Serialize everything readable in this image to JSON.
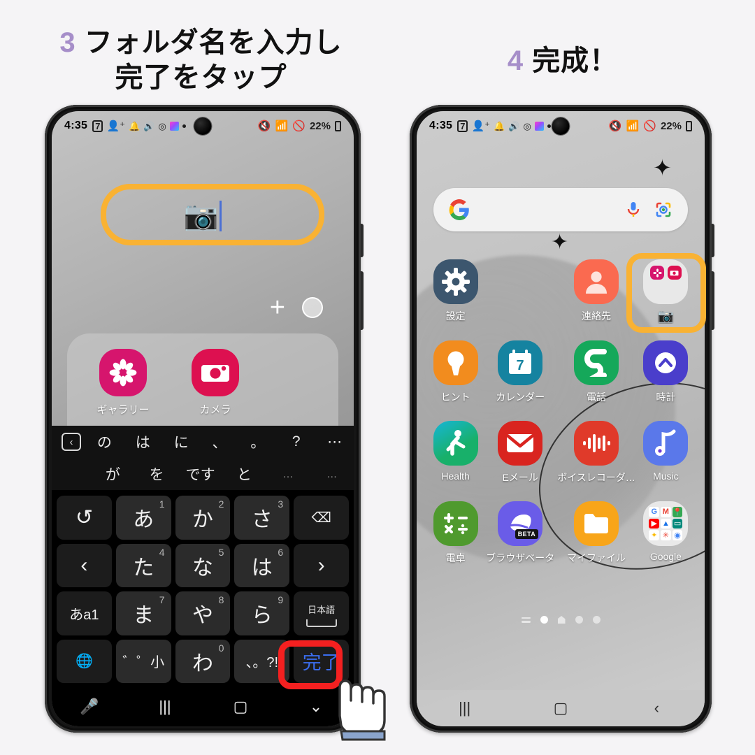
{
  "background_color": "#f5f4f6",
  "accent_color": "#a68ec9",
  "highlight_color": "#f9b233",
  "alert_color": "#f42020",
  "headings": {
    "left": {
      "number": "3",
      "line1": "フォルダ名を入力し",
      "line2": "完了をタップ"
    },
    "right": {
      "number": "4",
      "line1": "完成！",
      "line2": ""
    }
  },
  "status_bar": {
    "time": "4:35",
    "left_icons": [
      "calendar-icon",
      "add-contact-icon",
      "bell-icon",
      "volume-icon",
      "target-icon",
      "gallery-icon",
      "dot-icon"
    ],
    "right_icons": [
      "mute-icon",
      "wifi-icon",
      "dnd-icon"
    ],
    "battery": "22%"
  },
  "left_phone": {
    "folder_name_field": {
      "value": "📷",
      "caret": true
    },
    "tools": {
      "add_label": "+",
      "color_dot": "color-picker-dot"
    },
    "folder_apps": [
      {
        "label": "ギャラリー",
        "icon": "gallery-icon",
        "color": "#d6156d"
      },
      {
        "label": "カメラ",
        "icon": "camera-icon",
        "color": "#dd1050"
      }
    ],
    "keyboard": {
      "suggestions_row1": [
        "の",
        "は",
        "に",
        "、",
        "。",
        "?",
        "⋯"
      ],
      "suggestions_row2": [
        "が",
        "を",
        "です",
        "と",
        "…",
        "…"
      ],
      "keys": [
        {
          "label": "↺",
          "type": "fn",
          "name": "undo-key"
        },
        {
          "label": "あ",
          "num": "1",
          "type": "char",
          "name": "key-a"
        },
        {
          "label": "か",
          "num": "2",
          "type": "char",
          "name": "key-ka"
        },
        {
          "label": "さ",
          "num": "3",
          "type": "char",
          "name": "key-sa"
        },
        {
          "label": "⌫",
          "type": "fn",
          "name": "backspace-key"
        },
        {
          "label": "‹",
          "type": "fn",
          "name": "cursor-left-key"
        },
        {
          "label": "た",
          "num": "4",
          "type": "char",
          "name": "key-ta"
        },
        {
          "label": "な",
          "num": "5",
          "type": "char",
          "name": "key-na"
        },
        {
          "label": "は",
          "num": "6",
          "type": "char",
          "name": "key-ha"
        },
        {
          "label": "›",
          "type": "fn",
          "name": "cursor-right-key"
        },
        {
          "label": "あa1",
          "type": "fn-small",
          "name": "input-mode-key"
        },
        {
          "label": "ま",
          "num": "7",
          "type": "char",
          "name": "key-ma"
        },
        {
          "label": "や",
          "num": "8",
          "type": "char",
          "name": "key-ya"
        },
        {
          "label": "ら",
          "num": "9",
          "type": "char",
          "name": "key-ra"
        },
        {
          "label": "日本語",
          "type": "space",
          "name": "space-key"
        },
        {
          "label": "🌐",
          "type": "fn",
          "name": "globe-key"
        },
        {
          "label": "゛゜小",
          "type": "fn-small",
          "name": "dakuten-key"
        },
        {
          "label": "わ",
          "num": "0",
          "type": "char",
          "name": "key-wa"
        },
        {
          "label": "、。?!",
          "type": "fn-small",
          "name": "punctuation-key"
        },
        {
          "label": "完了",
          "type": "done",
          "name": "done-key"
        }
      ]
    },
    "nav_bar": [
      "mic-icon",
      "recents-icon",
      "home-icon",
      "hide-keyboard-icon"
    ]
  },
  "right_phone": {
    "search": {
      "placeholder": "",
      "logo": "google-g-icon",
      "mic": "mic-icon",
      "lens": "lens-icon"
    },
    "apps": [
      {
        "label": "設定",
        "icon": "settings-gear-icon",
        "color": "#3c566e"
      },
      {
        "label": "",
        "icon": "spacer",
        "color": "transparent"
      },
      {
        "label": "連絡先",
        "icon": "contacts-icon",
        "color": "#fa6a50"
      },
      {
        "label": "📷",
        "icon": "folder-icon",
        "color": "#f0f0f0"
      },
      {
        "label": "ヒント",
        "icon": "tips-bulb-icon",
        "color": "#f28c1e"
      },
      {
        "label": "カレンダー",
        "icon": "calendar-icon",
        "color": "#1583a0"
      },
      {
        "label": "電話",
        "icon": "phone-icon",
        "color": "#15a85a"
      },
      {
        "label": "時計",
        "icon": "clock-icon",
        "color": "#4a3ecb"
      },
      {
        "label": "Health",
        "icon": "health-icon",
        "color": "#18b06a"
      },
      {
        "label": "Eメール",
        "icon": "email-icon",
        "color": "#d9241f"
      },
      {
        "label": "ボイスレコーダ…",
        "icon": "voice-recorder-icon",
        "color": "#e03a2a"
      },
      {
        "label": "Music",
        "icon": "music-note-icon",
        "color": "#5a78ea"
      },
      {
        "label": "電卓",
        "icon": "calculator-icon",
        "color": "#4f9a2e"
      },
      {
        "label": "ブラウザベータ",
        "icon": "browser-beta-icon",
        "color": "#6a5ce8"
      },
      {
        "label": "マイファイル",
        "icon": "my-files-folder-icon",
        "color": "#f8a519"
      },
      {
        "label": "Google",
        "icon": "google-folder-icon",
        "color": "#f0f0f0"
      }
    ],
    "page_indicators": [
      "widgets-icon",
      "dot-active",
      "home-icon",
      "dot",
      "dot"
    ],
    "nav_bar": [
      "recents-icon",
      "home-icon",
      "back-icon"
    ]
  }
}
